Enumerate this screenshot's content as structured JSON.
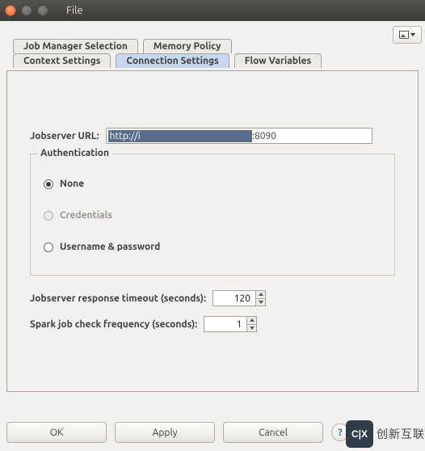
{
  "title": "File",
  "tabs": {
    "row1": [
      "Job Manager Selection",
      "Memory Policy"
    ],
    "row2": [
      "Context Settings",
      "Connection Settings",
      "Flow Variables"
    ],
    "selected": "Connection Settings"
  },
  "form": {
    "url_label": "Jobserver URL:",
    "url_prefix": "http://i",
    "url_port": ":8090",
    "auth_legend": "Authentication",
    "auth_options": {
      "none": "None",
      "credentials": "Credentials",
      "userpass": "Username & password"
    },
    "auth_selected": "none",
    "timeout_label": "Jobserver response timeout (seconds):",
    "timeout_value": "120",
    "freq_label": "Spark job check frequency (seconds):",
    "freq_value": "1"
  },
  "buttons": {
    "ok": "OK",
    "apply": "Apply",
    "cancel": "Cancel",
    "help": "?"
  },
  "watermark": {
    "badge": "C|X",
    "text": "创新互联"
  }
}
